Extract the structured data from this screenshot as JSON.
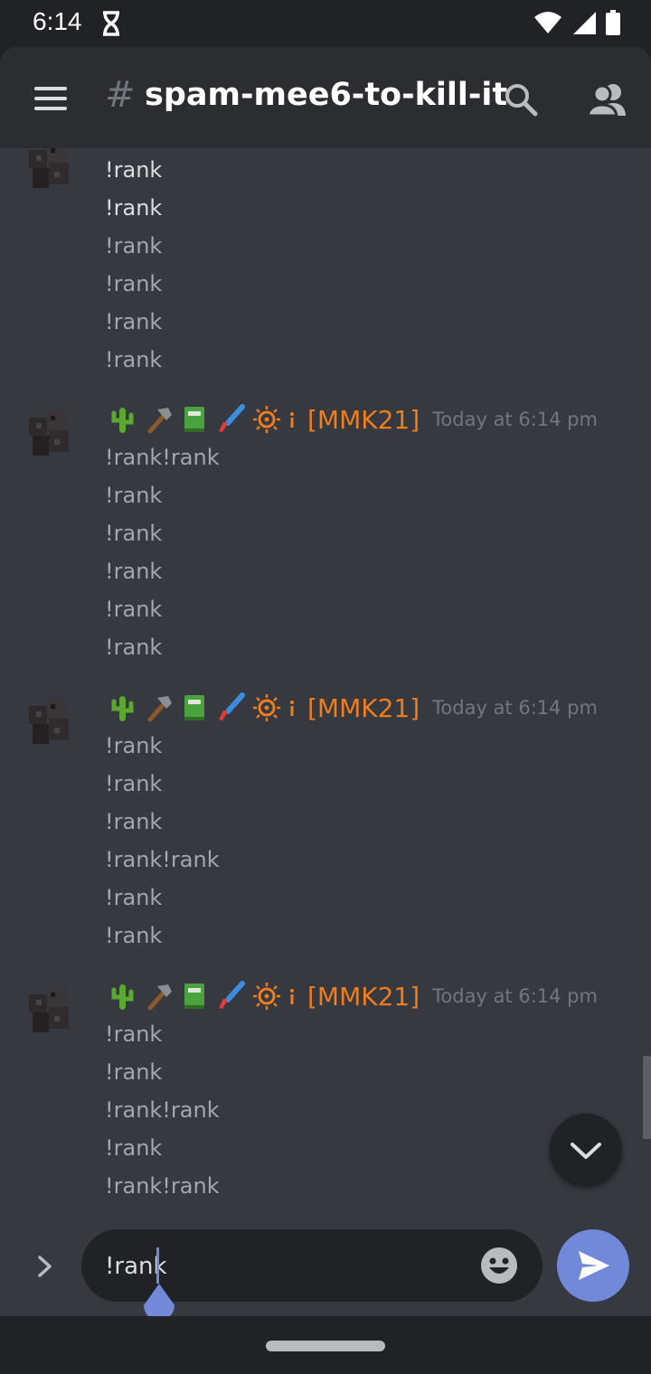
{
  "status_bar": {
    "time": "6:14"
  },
  "header": {
    "hash_symbol": "#",
    "channel_name": "spam-mee6-to-kill-it"
  },
  "messages": {
    "first_group_lines": [
      "!rank",
      "!rank",
      "!rank",
      "!rank",
      "!rank",
      "!rank"
    ],
    "groups": [
      {
        "author": "[MMK21]",
        "timestamp": "Today at 6:14 pm",
        "emojis": [
          "cactus-icon",
          "hammer-icon",
          "green-book-icon",
          "paintbrush-icon",
          "sun-icon",
          "info-icon"
        ],
        "lines": [
          "!rank!rank",
          "!rank",
          "!rank",
          "!rank",
          "!rank",
          "!rank"
        ]
      },
      {
        "author": "[MMK21]",
        "timestamp": "Today at 6:14 pm",
        "emojis": [
          "cactus-icon",
          "hammer-icon",
          "green-book-icon",
          "paintbrush-icon",
          "sun-icon",
          "info-icon"
        ],
        "lines": [
          "!rank",
          "!rank",
          "!rank",
          "!rank!rank",
          "!rank",
          "!rank"
        ]
      },
      {
        "author": "[MMK21]",
        "timestamp": "Today at 6:14 pm",
        "emojis": [
          "cactus-icon",
          "hammer-icon",
          "green-book-icon",
          "paintbrush-icon",
          "sun-icon",
          "info-icon"
        ],
        "lines": [
          "!rank",
          "!rank",
          "!rank!rank",
          "!rank",
          "!rank!rank"
        ]
      }
    ]
  },
  "composer": {
    "input_value": "!rank"
  },
  "colors": {
    "author": "#ed7d1f",
    "accent": "#7289da",
    "background": "#36393f",
    "header_bg": "#2b2d31"
  }
}
